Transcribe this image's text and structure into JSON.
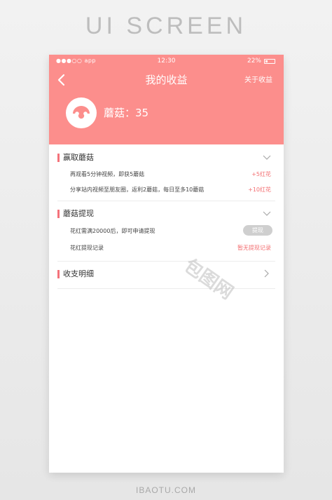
{
  "banner": {
    "title": "UI SCREEN"
  },
  "statusbar": {
    "carrier": "●●●○○ app",
    "time": "12:30",
    "battery": "22%"
  },
  "header": {
    "title": "我的收益",
    "about": "关于收益",
    "mushroom_label": "蘑菇：35"
  },
  "sections": [
    {
      "title": "赢取蘑菇",
      "rows": [
        {
          "text": "再观看5分钟视频，即获5蘑菇",
          "value": "+5红花"
        },
        {
          "text": "分享站内视频至朋友圈，返利2蘑菇，每日至多10蘑菇",
          "value": "+10红花"
        }
      ]
    },
    {
      "title": "蘑菇提现",
      "rows": [
        {
          "text": "花红需满20000后，即可申请提现",
          "button": "提现"
        },
        {
          "text": "花红提现记录",
          "value": "暂无提现记录"
        }
      ]
    },
    {
      "title": "收支明细"
    }
  ],
  "watermark": "包图网",
  "footer": {
    "text": "IBAOTU.COM"
  },
  "colors": {
    "header": "#fc8e8c",
    "accent": "#f4727a"
  }
}
